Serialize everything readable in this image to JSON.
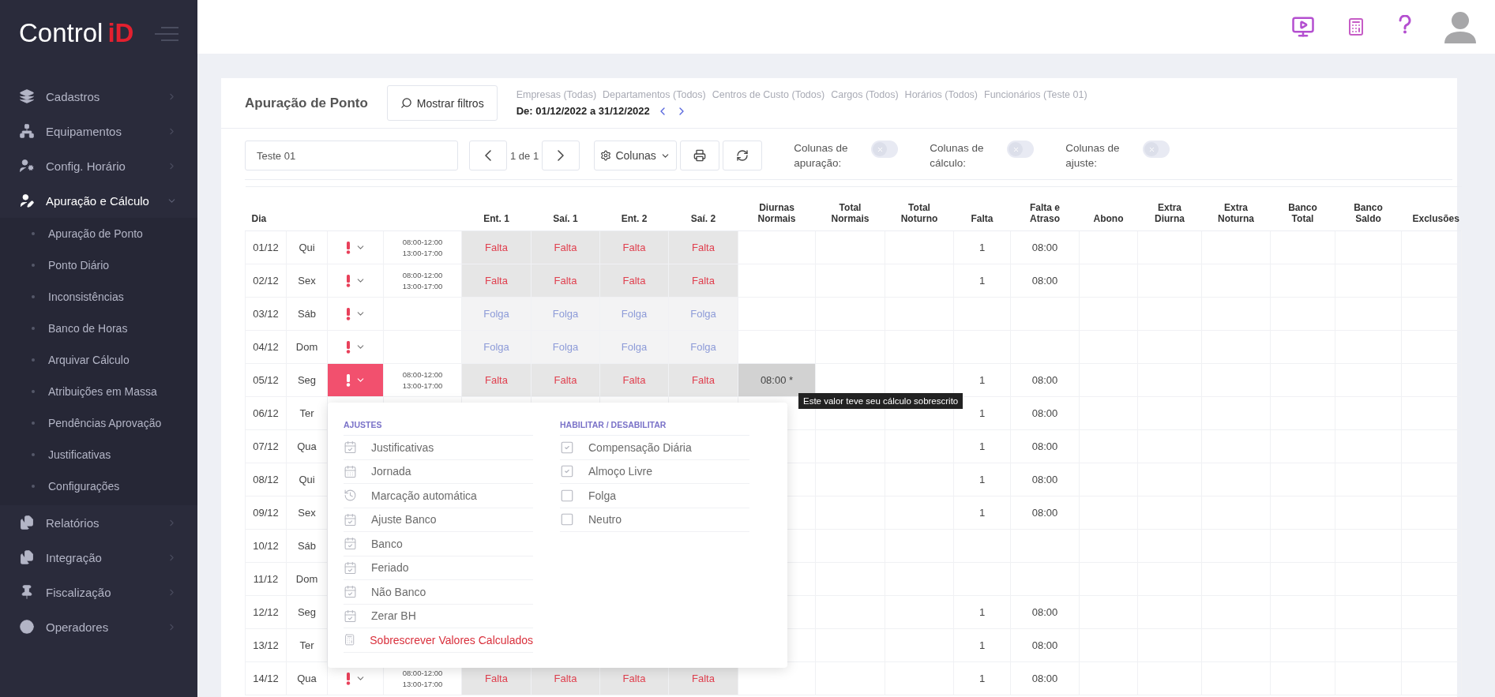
{
  "logo": {
    "text": "Control",
    "mark": "iD"
  },
  "sidebar": {
    "items": [
      {
        "label": "Cadastros",
        "expanded": false
      },
      {
        "label": "Equipamentos",
        "expanded": false
      },
      {
        "label": "Config. Horário",
        "expanded": false
      },
      {
        "label": "Apuração e Cálculo",
        "expanded": true,
        "children": [
          {
            "label": "Apuração de Ponto"
          },
          {
            "label": "Ponto Diário"
          },
          {
            "label": "Inconsistências"
          },
          {
            "label": "Banco de Horas"
          },
          {
            "label": "Arquivar Cálculo"
          },
          {
            "label": "Atribuições em Massa"
          },
          {
            "label": "Pendências Aprovação"
          },
          {
            "label": "Justificativas"
          },
          {
            "label": "Configurações"
          }
        ]
      },
      {
        "label": "Relatórios",
        "expanded": false
      },
      {
        "label": "Integração",
        "expanded": false
      },
      {
        "label": "Fiscalização",
        "expanded": false
      },
      {
        "label": "Operadores",
        "expanded": false
      }
    ]
  },
  "page": {
    "title": "Apuração de Ponto",
    "filter_button": "Mostrar filtros",
    "filters": [
      "Empresas (Todas)",
      "Departamentos (Todos)",
      "Centros de Custo (Todos)",
      "Cargos (Todos)",
      "Horários (Todos)",
      "Funcionários (Teste 01)"
    ],
    "date_range": "De: 01/12/2022 a 31/12/2022"
  },
  "toolbar": {
    "search_value": "Teste 01",
    "pager": "1 de 1",
    "columns_button": "Colunas",
    "toggles": [
      {
        "label": "Colunas de apuração:",
        "on": false
      },
      {
        "label": "Colunas de cálculo:",
        "on": false
      },
      {
        "label": "Colunas de ajuste:",
        "on": false
      }
    ]
  },
  "table": {
    "columns": [
      "Dia",
      "Ent. 1",
      "Saí. 1",
      "Ent. 2",
      "Saí. 2",
      "Diurnas Normais",
      "Total Normais",
      "Total Noturno",
      "Falta",
      "Falta e Atraso",
      "Abono",
      "Extra Diurna",
      "Extra Noturna",
      "Banco Total",
      "Banco Saldo",
      "Exclusões"
    ],
    "rows": [
      {
        "date": "01/12",
        "weekday": "Qui",
        "status": {
          "expanded": false
        },
        "hours": [
          "08:00-12:00",
          "13:00-17:00"
        ],
        "marks": [
          {
            "kind": "falta",
            "text": "Falta"
          },
          {
            "kind": "falta",
            "text": "Falta"
          },
          {
            "kind": "falta",
            "text": "Falta"
          },
          {
            "kind": "falta",
            "text": "Falta"
          }
        ],
        "falta": "1",
        "falta_e_atraso": "08:00"
      },
      {
        "date": "02/12",
        "weekday": "Sex",
        "status": {
          "expanded": false
        },
        "hours": [
          "08:00-12:00",
          "13:00-17:00"
        ],
        "marks": [
          {
            "kind": "falta",
            "text": "Falta"
          },
          {
            "kind": "falta",
            "text": "Falta"
          },
          {
            "kind": "falta",
            "text": "Falta"
          },
          {
            "kind": "falta",
            "text": "Falta"
          }
        ],
        "falta": "1",
        "falta_e_atraso": "08:00"
      },
      {
        "date": "03/12",
        "weekday": "Sáb",
        "status": {
          "expanded": false
        },
        "marks": [
          {
            "kind": "folga",
            "text": "Folga"
          },
          {
            "kind": "folga",
            "text": "Folga"
          },
          {
            "kind": "folga",
            "text": "Folga"
          },
          {
            "kind": "folga",
            "text": "Folga"
          }
        ]
      },
      {
        "date": "04/12",
        "weekday": "Dom",
        "status": {
          "expanded": false
        },
        "marks": [
          {
            "kind": "folga",
            "text": "Folga"
          },
          {
            "kind": "folga",
            "text": "Folga"
          },
          {
            "kind": "folga",
            "text": "Folga"
          },
          {
            "kind": "folga",
            "text": "Folga"
          }
        ]
      },
      {
        "date": "05/12",
        "weekday": "Seg",
        "status": {
          "expanded": true
        },
        "hours": [
          "08:00-12:00",
          "13:00-17:00"
        ],
        "marks": [
          {
            "kind": "falta",
            "text": "Falta"
          },
          {
            "kind": "falta",
            "text": "Falta"
          },
          {
            "kind": "falta",
            "text": "Falta"
          },
          {
            "kind": "falta",
            "text": "Falta"
          }
        ],
        "diurnas": {
          "text": "08:00 *",
          "overridden": true,
          "tooltip": "Este valor teve seu cálculo sobrescrito"
        },
        "falta": "1",
        "falta_e_atraso": "08:00"
      },
      {
        "date": "06/12",
        "weekday": "Ter",
        "falta": "1",
        "falta_e_atraso": "08:00"
      },
      {
        "date": "07/12",
        "weekday": "Qua",
        "falta": "1",
        "falta_e_atraso": "08:00"
      },
      {
        "date": "08/12",
        "weekday": "Qui",
        "falta": "1",
        "falta_e_atraso": "08:00"
      },
      {
        "date": "09/12",
        "weekday": "Sex",
        "falta": "1",
        "falta_e_atraso": "08:00"
      },
      {
        "date": "10/12",
        "weekday": "Sáb"
      },
      {
        "date": "11/12",
        "weekday": "Dom"
      },
      {
        "date": "12/12",
        "weekday": "Seg",
        "falta": "1",
        "falta_e_atraso": "08:00"
      },
      {
        "date": "13/12",
        "weekday": "Ter",
        "falta": "1",
        "falta_e_atraso": "08:00"
      },
      {
        "date": "14/12",
        "weekday": "Qua",
        "status": {
          "expanded": false
        },
        "hours": [
          "08:00-12:00",
          "13:00-17:00"
        ],
        "marks": [
          {
            "kind": "falta",
            "text": "Falta"
          },
          {
            "kind": "falta",
            "text": "Falta"
          },
          {
            "kind": "falta",
            "text": "Falta"
          },
          {
            "kind": "falta",
            "text": "Falta"
          }
        ],
        "falta": "1",
        "falta_e_atraso": "08:00"
      }
    ]
  },
  "menu": {
    "left_title": "AJUSTES",
    "left_items": [
      {
        "label": "Justificativas",
        "color": "#6b6b6b"
      },
      {
        "label": "Jornada",
        "color": "#6b6b6b"
      },
      {
        "label": "Marcação automática",
        "color": "#6b6b6b"
      },
      {
        "label": "Ajuste Banco",
        "color": "#6b6b6b"
      },
      {
        "label": "Banco",
        "color": "#6b6b6b"
      },
      {
        "label": "Feriado",
        "color": "#6b6b6b"
      },
      {
        "label": "Não Banco",
        "color": "#6b6b6b"
      },
      {
        "label": "Zerar BH",
        "color": "#6b6b6b"
      },
      {
        "label": "Sobrescrever Valores Calculados",
        "color": "#d9303c"
      }
    ],
    "right_title": "HABILITAR / DESABILITAR",
    "right_items": [
      {
        "label": "Compensação Diária",
        "checked": true
      },
      {
        "label": "Almoço Livre",
        "checked": true
      },
      {
        "label": "Folga",
        "checked": false
      },
      {
        "label": "Neutro",
        "checked": false
      }
    ]
  }
}
